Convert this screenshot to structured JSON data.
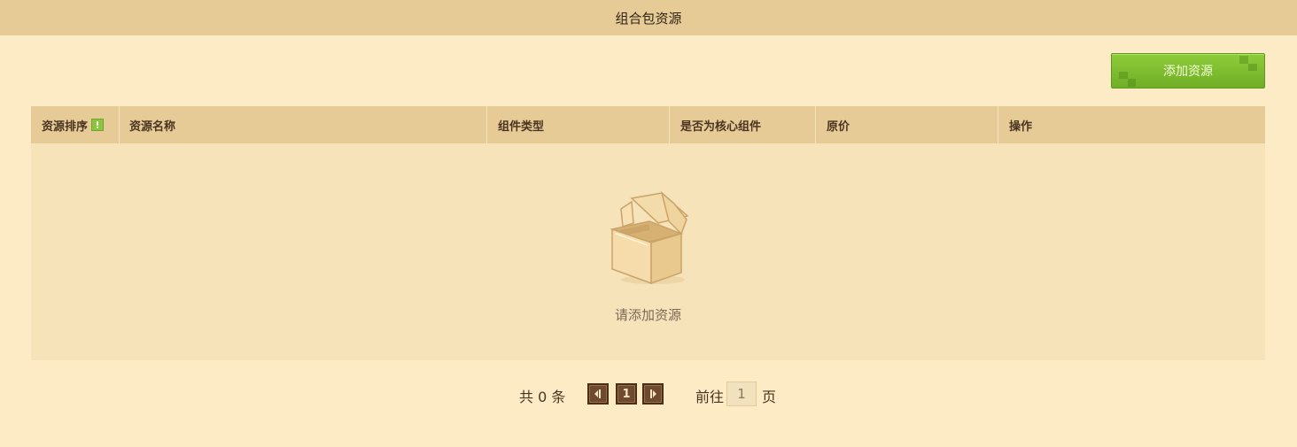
{
  "header": {
    "title": "组合包资源"
  },
  "toolbar": {
    "add_label": "添加资源"
  },
  "table": {
    "columns": [
      {
        "label": "资源排序",
        "badge": "!"
      },
      {
        "label": "资源名称"
      },
      {
        "label": "组件类型"
      },
      {
        "label": "是否为核心组件"
      },
      {
        "label": "原价"
      },
      {
        "label": "操作"
      }
    ],
    "rows": [],
    "empty_text": "请添加资源",
    "empty_icon": "open-box-icon"
  },
  "pagination": {
    "total_text": "共 0 条",
    "current_page": "1",
    "goto_label": "前往",
    "goto_value": "1",
    "page_suffix": "页",
    "prev_icon": "prev-arrow-icon",
    "next_icon": "next-arrow-icon"
  },
  "colors": {
    "background": "#fcebc4",
    "header_bar": "#e6cb97",
    "table_body": "#f7e3ba",
    "accent_green": "#7dbb2e",
    "pager_button": "#6e4a2e"
  }
}
